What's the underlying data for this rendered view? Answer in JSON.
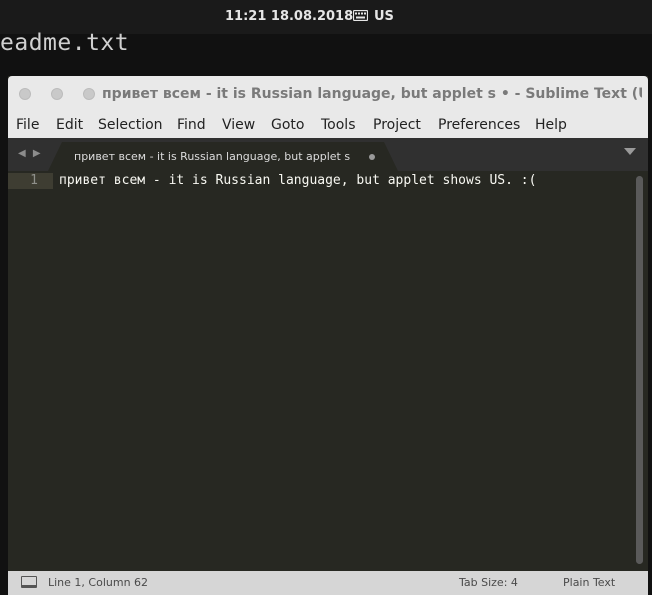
{
  "top_panel": {
    "clock": "11:21  18.08.2018",
    "keyboard_layout": "US"
  },
  "desktop": {
    "background_filename": "eadme.txt"
  },
  "window": {
    "title": "привет всем - it is Russian language, but applet s • - Sublime Text (UNREGISTERED)",
    "menu": [
      "File",
      "Edit",
      "Selection",
      "Find",
      "View",
      "Goto",
      "Tools",
      "Project",
      "Preferences",
      "Help"
    ],
    "tab": {
      "label": "привет всем - it is Russian language, but applet s",
      "modified": true
    },
    "editor": {
      "line_numbers": [
        "1"
      ],
      "lines": [
        "привет всем - it is Russian language, but applet shows US. :("
      ]
    },
    "status": {
      "position": "Line 1, Column 62",
      "tab_size": "Tab Size: 4",
      "syntax": "Plain Text"
    }
  },
  "colors": {
    "editor_bg": "#272822",
    "editor_fg": "#f8f8f2",
    "chrome_bg": "#e9e9e9",
    "tabbar_bg": "#303030",
    "statusbar_bg": "#d6d6d6"
  }
}
